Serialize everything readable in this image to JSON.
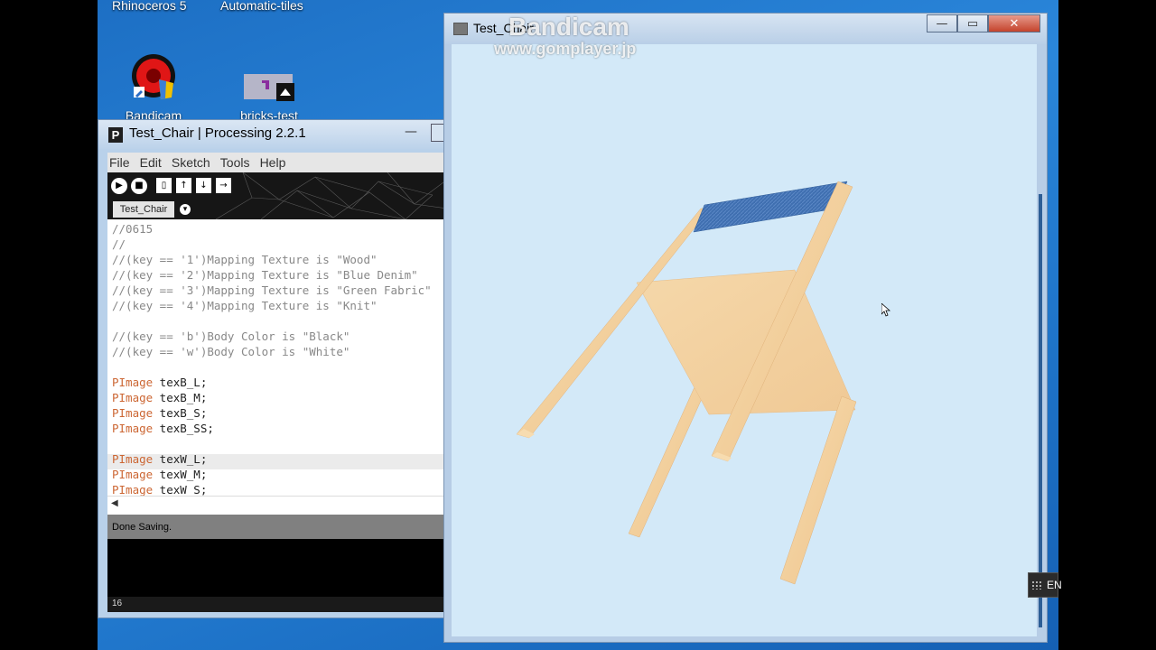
{
  "desktop": {
    "top_labels": [
      "Rhinoceros 5",
      "Automatic-tiles"
    ],
    "icons": [
      {
        "label": "Bandicam",
        "icon": "bandicam-icon"
      },
      {
        "label": "bricks-test",
        "icon": "image-file-icon"
      }
    ]
  },
  "processing_window": {
    "title": "Test_Chair | Processing 2.2.1",
    "minimize_glyph": "—",
    "menu": [
      "File",
      "Edit",
      "Sketch",
      "Tools",
      "Help"
    ],
    "toolbar": {
      "run": "▶",
      "stop": "■",
      "new": "▯",
      "open": "↑",
      "save": "↓",
      "export": "→"
    },
    "tab_label": "Test_Chair",
    "tab_menu_glyph": "▾",
    "code_lines": [
      {
        "plain": "//0615"
      },
      {
        "plain": "//"
      },
      {
        "plain": "//(key == '1')Mapping Texture is \"Wood\""
      },
      {
        "plain": "//(key == '2')Mapping Texture is \"Blue Denim\""
      },
      {
        "plain": "//(key == '3')Mapping Texture is \"Green Fabric\""
      },
      {
        "plain": "//(key == '4')Mapping Texture is \"Knit\""
      },
      {
        "plain": ""
      },
      {
        "plain": "//(key == 'b')Body Color is \"Black\""
      },
      {
        "plain": "//(key == 'w')Body Color is \"White\""
      },
      {
        "plain": ""
      },
      {
        "kw": "PImage",
        "text": " texB_L;"
      },
      {
        "kw": "PImage",
        "text": " texB_M;"
      },
      {
        "kw": "PImage",
        "text": " texB_S;"
      },
      {
        "kw": "PImage",
        "text": " texB_SS;"
      },
      {
        "plain": ""
      },
      {
        "kw": "PImage",
        "text": " texW_L;"
      },
      {
        "kw": "PImage",
        "text": " texW_M;"
      },
      {
        "kw": "PImage",
        "text": " texW_S;"
      }
    ],
    "scroll_left_glyph": "◀",
    "status": "Done Saving.",
    "line_number": "16"
  },
  "sketch_window": {
    "title": "Test_Chair",
    "min_glyph": "—",
    "max_glyph": "▭",
    "close_glyph": "✕"
  },
  "watermark": {
    "brand": "Bandicam",
    "url": "www.gomplayer.jp"
  },
  "tray": {
    "ime_label": "EN"
  },
  "colors": {
    "canvas_bg": "#d3e9f8",
    "wood": "#f2cf9c",
    "denim": "#3f6fb0",
    "keyword": "#cc6633"
  }
}
